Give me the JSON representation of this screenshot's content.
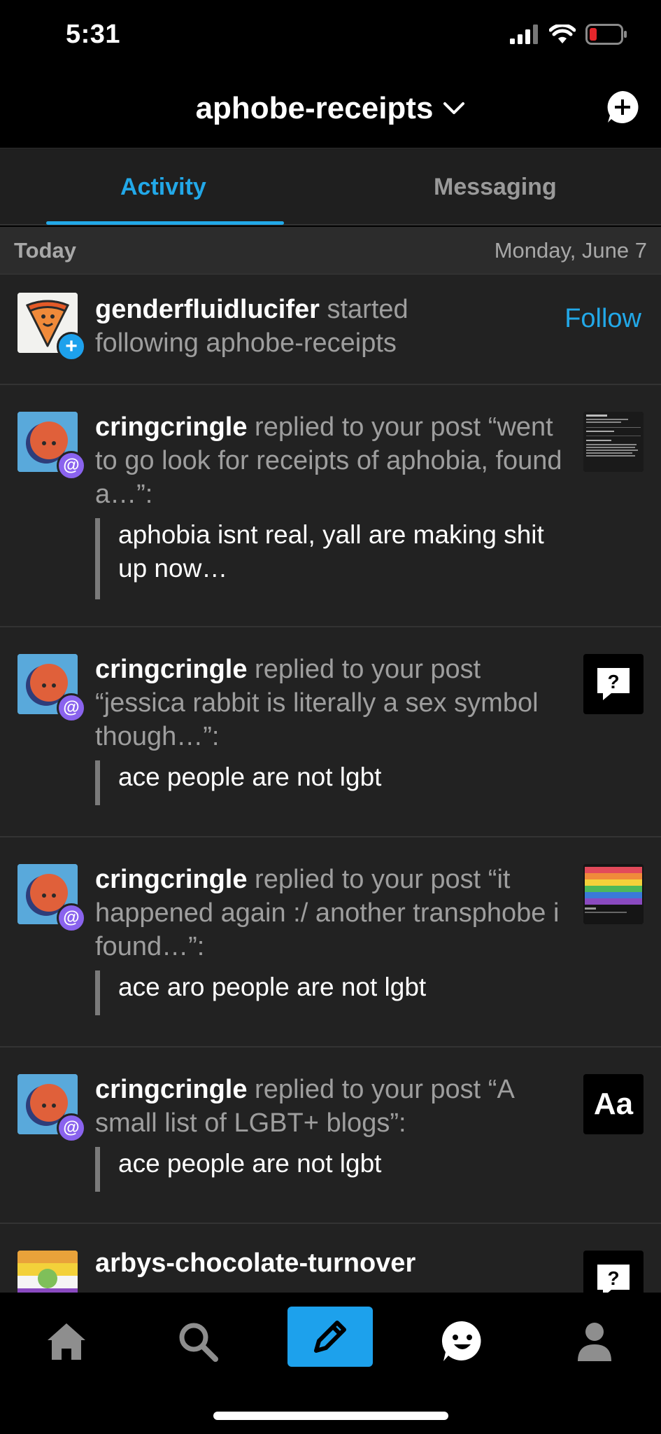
{
  "status_bar": {
    "time": "5:31",
    "battery_color": "#e5262b"
  },
  "header": {
    "blog_name": "aphobe-receipts"
  },
  "tabs": [
    {
      "label": "Activity",
      "active": true
    },
    {
      "label": "Messaging",
      "active": false
    }
  ],
  "section": {
    "left": "Today",
    "right": "Monday, June 7"
  },
  "items": [
    {
      "user": "genderfluidlucifer",
      "text": " started following aphobe-receipts",
      "action": "Follow"
    },
    {
      "user": "cringcringle",
      "text": " replied to your post “went to go look for receipts of aphobia, found a…”:",
      "quote": "aphobia isnt real, yall are making shit up now…"
    },
    {
      "user": "cringcringle",
      "text": " replied to your post “jessica rabbit is literally a sex symbol though…”:",
      "quote": "ace people are not lgbt",
      "thumb": "?"
    },
    {
      "user": "cringcringle",
      "text": " replied to your post “it happened again :/ another transphobe i found…”:",
      "quote": "ace aro people are not lgbt"
    },
    {
      "user": "cringcringle",
      "text": " replied to your post “A small list of LGBT+ blogs”:",
      "quote": "ace people are not lgbt",
      "thumb": "Aa"
    },
    {
      "user": "arbys-chocolate-turnover",
      "text": "",
      "thumb": "?"
    }
  ],
  "colors": {
    "accent": "#22a8e8",
    "mention_badge": "#8a63ee",
    "follow_badge": "#1da1ec",
    "background": "#222222"
  },
  "nav": [
    {
      "name": "home-icon"
    },
    {
      "name": "search-icon"
    },
    {
      "name": "compose-icon"
    },
    {
      "name": "activity-face-icon"
    },
    {
      "name": "account-icon"
    }
  ]
}
